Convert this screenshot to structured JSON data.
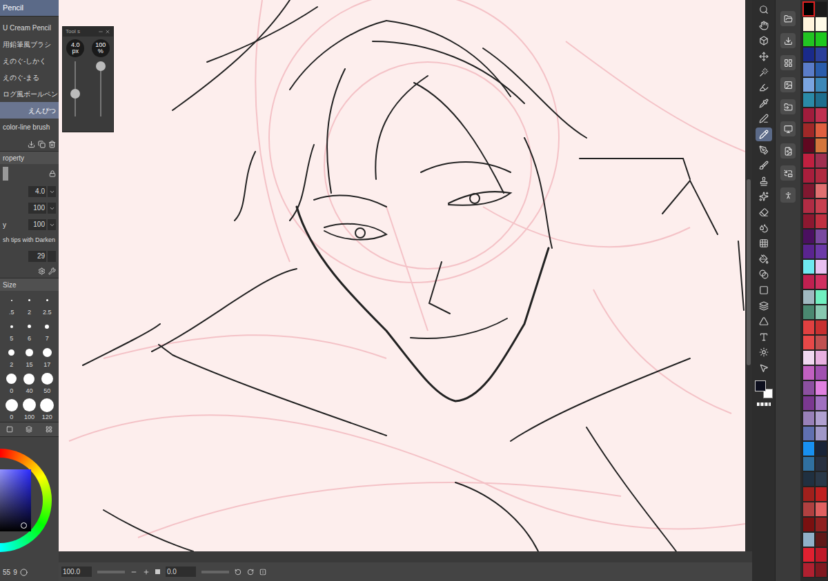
{
  "sub_tool": {
    "tab": "Pencil",
    "brushes": [
      {
        "label": "U Cream Pencil",
        "selected": false
      },
      {
        "label": "用鉛筆風ブラシ",
        "selected": false
      },
      {
        "label": "えのぐ-しかく",
        "selected": false
      },
      {
        "label": "えのぐ-まる",
        "selected": false
      },
      {
        "label": "ログ風ボールペン",
        "selected": false
      },
      {
        "label": "えんぴつ",
        "selected": true
      },
      {
        "label": "color-line brush",
        "selected": false
      }
    ]
  },
  "tool_property": {
    "title": "roperty",
    "fields": [
      {
        "label": "",
        "value": "4.0"
      },
      {
        "label": "",
        "value": "100"
      },
      {
        "label": "y",
        "value": "100"
      }
    ],
    "option": "sh tips with Darken",
    "value": "29"
  },
  "brush_size": {
    "title": "Size",
    "sizes": [
      ".5",
      "2",
      "2.5",
      "5",
      "6",
      "7",
      "2",
      "15",
      "17",
      "0",
      "40",
      "50",
      "0",
      "100",
      "120"
    ]
  },
  "tool_window": {
    "title": "Tool s",
    "size": {
      "reading": "4.0",
      "unit": "px",
      "level": 0.4
    },
    "opacity": {
      "reading": "100",
      "unit": "%",
      "level": 1
    }
  },
  "toolbar": {
    "tools": [
      {
        "selected": false
      },
      {
        "selected": false
      },
      {
        "selected": false
      },
      {
        "selected": false
      },
      {
        "selected": false
      },
      {
        "selected": false
      },
      {
        "selected": false
      },
      {
        "selected": false
      },
      {
        "selected": true
      },
      {
        "selected": false
      },
      {
        "selected": false
      },
      {
        "selected": false
      },
      {
        "selected": false
      },
      {
        "selected": false
      },
      {
        "selected": false
      },
      {
        "selected": false
      },
      {
        "selected": false
      },
      {
        "selected": false
      },
      {
        "selected": false
      },
      {
        "selected": false
      },
      {
        "selected": false
      },
      {
        "selected": false
      },
      {
        "selected": false
      },
      {
        "selected": false
      }
    ]
  },
  "main_color": {
    "color": "#0d0f1e"
  },
  "palette": {
    "colors": [
      {
        "color": "#000000",
        "selected": true
      },
      {
        "color": "#1a1a1a",
        "selected": false
      },
      {
        "color": "#fff4dc",
        "selected": false
      },
      {
        "color": "#fffbe8",
        "selected": false
      },
      {
        "color": "#22c422",
        "selected": false
      },
      {
        "color": "#1ec81e",
        "selected": false
      },
      {
        "color": "#1a2a8a",
        "selected": false
      },
      {
        "color": "#2b3f9a",
        "selected": false
      },
      {
        "color": "#5a7cc8",
        "selected": false
      },
      {
        "color": "#2a5cab",
        "selected": false
      },
      {
        "color": "#7aa4e0",
        "selected": false
      },
      {
        "color": "#3d88b8",
        "selected": false
      },
      {
        "color": "#2a8aa8",
        "selected": false
      },
      {
        "color": "#1e6e8e",
        "selected": false
      },
      {
        "color": "#a01c3c",
        "selected": false
      },
      {
        "color": "#c03050",
        "selected": false
      },
      {
        "color": "#a02828",
        "selected": false
      },
      {
        "color": "#e06040",
        "selected": false
      },
      {
        "color": "#600820",
        "selected": false
      },
      {
        "color": "#d4763c",
        "selected": false
      },
      {
        "color": "#c02040",
        "selected": false
      },
      {
        "color": "#a03050",
        "selected": false
      },
      {
        "color": "#a81e3c",
        "selected": false
      },
      {
        "color": "#b02a40",
        "selected": false
      },
      {
        "color": "#801830",
        "selected": false
      },
      {
        "color": "#e07070",
        "selected": false
      },
      {
        "color": "#b02c44",
        "selected": false
      },
      {
        "color": "#c84050",
        "selected": false
      },
      {
        "color": "#8c1830",
        "selected": false
      },
      {
        "color": "#c03040",
        "selected": false
      },
      {
        "color": "#4a1060",
        "selected": false
      },
      {
        "color": "#7a4aa0",
        "selected": false
      },
      {
        "color": "#5a2490",
        "selected": false
      },
      {
        "color": "#6c3aa8",
        "selected": false
      },
      {
        "color": "#6ee8f0",
        "selected": false
      },
      {
        "color": "#e8c0f0",
        "selected": false
      },
      {
        "color": "#c02050",
        "selected": false
      },
      {
        "color": "#d03060",
        "selected": false
      },
      {
        "color": "#a0b8c0",
        "selected": false
      },
      {
        "color": "#70f0c0",
        "selected": false
      },
      {
        "color": "#4a8870",
        "selected": false
      },
      {
        "color": "#88c8b0",
        "selected": false
      },
      {
        "color": "#e04040",
        "selected": false
      },
      {
        "color": "#c83030",
        "selected": false
      },
      {
        "color": "#e84848",
        "selected": false
      },
      {
        "color": "#c05050",
        "selected": false
      },
      {
        "color": "#f0d8f0",
        "selected": false
      },
      {
        "color": "#e8b0e0",
        "selected": false
      },
      {
        "color": "#c060c0",
        "selected": false
      },
      {
        "color": "#a050b0",
        "selected": false
      },
      {
        "color": "#8c50a0",
        "selected": false
      },
      {
        "color": "#e080e0",
        "selected": false
      },
      {
        "color": "#7a3890",
        "selected": false
      },
      {
        "color": "#a070c0",
        "selected": false
      },
      {
        "color": "#9880b8",
        "selected": false
      },
      {
        "color": "#b0a0d0",
        "selected": false
      },
      {
        "color": "#6070b0",
        "selected": false
      },
      {
        "color": "#a098c8",
        "selected": false
      },
      {
        "color": "#1890f0",
        "selected": false
      },
      {
        "color": "#1a2438",
        "selected": false
      },
      {
        "color": "#3070a0",
        "selected": false
      },
      {
        "color": "#283040",
        "selected": false
      },
      {
        "color": "#203040",
        "selected": false
      },
      {
        "color": "#2a3848",
        "selected": false
      },
      {
        "color": "#a0201c",
        "selected": false
      },
      {
        "color": "#c02020",
        "selected": false
      },
      {
        "color": "#b04040",
        "selected": false
      },
      {
        "color": "#e06060",
        "selected": false
      },
      {
        "color": "#7a1010",
        "selected": false
      },
      {
        "color": "#902020",
        "selected": false
      },
      {
        "color": "#90b0c8",
        "selected": false
      },
      {
        "color": "#601818",
        "selected": false
      },
      {
        "color": "#e02030",
        "selected": false
      },
      {
        "color": "#c01828",
        "selected": false
      },
      {
        "color": "#b02030",
        "selected": false
      },
      {
        "color": "#801820",
        "selected": false
      }
    ]
  },
  "status_bar": {
    "zoom": "100.0",
    "angle": "0.0"
  },
  "footer": {
    "layers": "55",
    "count": "9"
  }
}
